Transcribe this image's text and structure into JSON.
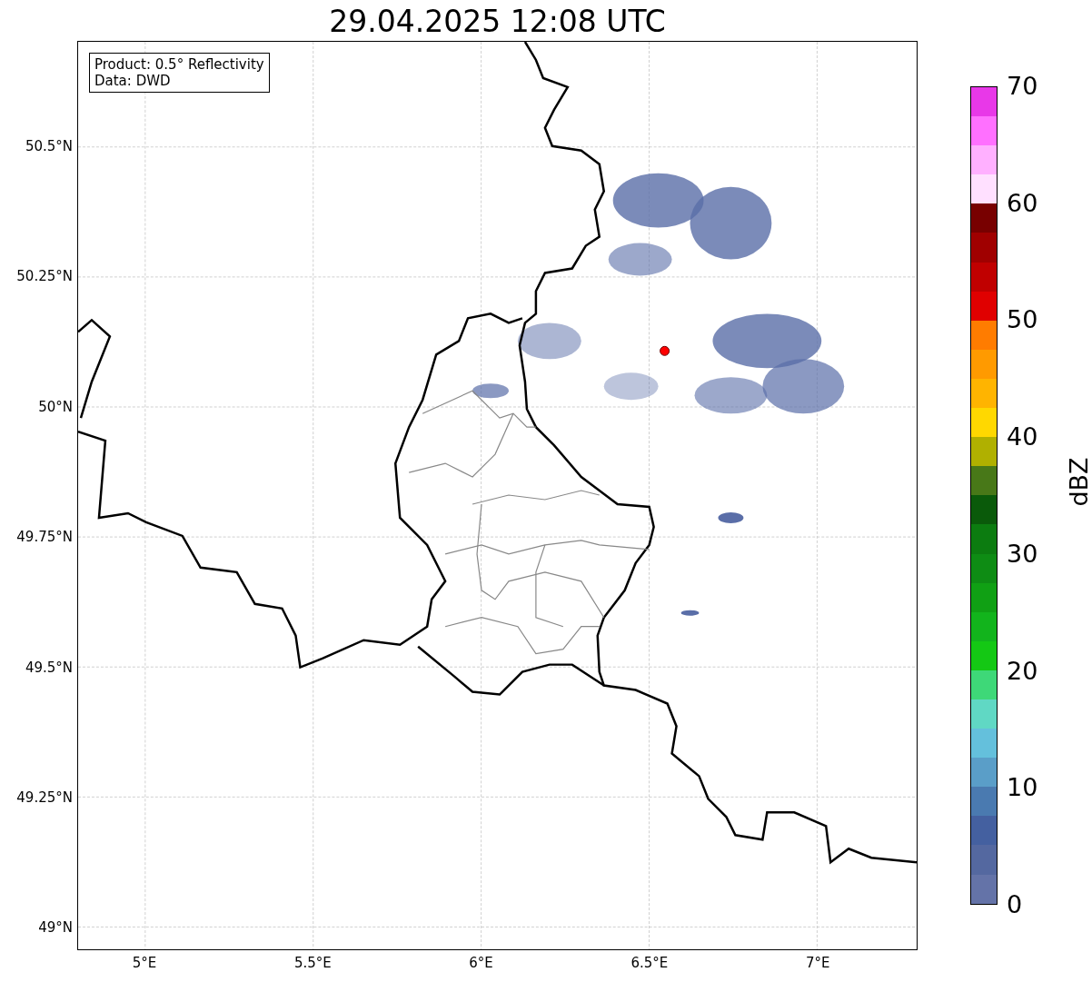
{
  "title": "29.04.2025 12:08 UTC",
  "map": {
    "info_box": [
      "Product: 0.5° Reflectivity",
      "Data: DWD"
    ],
    "lat_ticks": [
      "50.5°N",
      "50.25°N",
      "50°N",
      "49.75°N",
      "49.5°N",
      "49.25°N",
      "49°N"
    ],
    "lon_ticks": [
      "5°E",
      "5.5°E",
      "6°E",
      "6.5°E",
      "7°E"
    ]
  },
  "colorbar": {
    "label": "dBZ",
    "ticks": [
      "70",
      "60",
      "50",
      "40",
      "30",
      "20",
      "10",
      "0"
    ],
    "bands": [
      {
        "color": "#e838e8"
      },
      {
        "color": "#ff70ff"
      },
      {
        "color": "#ffb0ff"
      },
      {
        "color": "#ffe0ff"
      },
      {
        "color": "#780000"
      },
      {
        "color": "#a00000"
      },
      {
        "color": "#c00000"
      },
      {
        "color": "#e00000"
      },
      {
        "color": "#ff7c00"
      },
      {
        "color": "#ff9a00"
      },
      {
        "color": "#ffb400"
      },
      {
        "color": "#ffd800"
      },
      {
        "color": "#b0b000"
      },
      {
        "color": "#487818"
      },
      {
        "color": "#0a5a0a"
      },
      {
        "color": "#0c7c10"
      },
      {
        "color": "#0e8c14"
      },
      {
        "color": "#10a014"
      },
      {
        "color": "#12b41c"
      },
      {
        "color": "#14c814"
      },
      {
        "color": "#3ed878"
      },
      {
        "color": "#60d8c4"
      },
      {
        "color": "#64c0dc"
      },
      {
        "color": "#5a9ec8"
      },
      {
        "color": "#4a7ab0"
      },
      {
        "color": "#4460a0"
      },
      {
        "color": "#5468a0"
      },
      {
        "color": "#6473a8"
      }
    ]
  }
}
